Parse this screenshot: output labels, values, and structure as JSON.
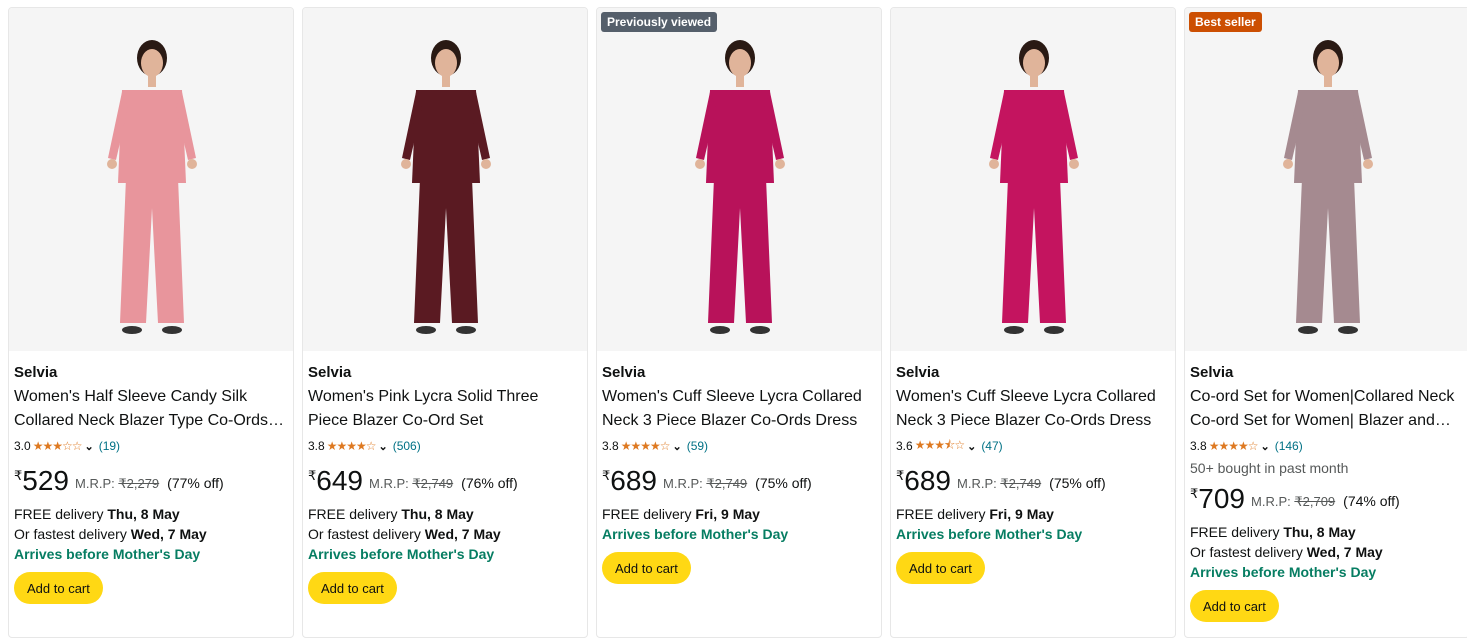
{
  "products": [
    {
      "badge": "",
      "brand": "Selvia",
      "title": "Women's Half Sleeve Candy Silk Collared Neck Blazer Type Co-Ords Set",
      "rating": "3.0",
      "stars": "★★★☆☆",
      "reviews": "(19)",
      "bought": "",
      "currency": "₹",
      "price": "529",
      "mrp_label": "M.R.P:",
      "mrp": "₹2,279",
      "discount": "(77% off)",
      "delivery_prefix": "FREE delivery",
      "delivery_date": "Thu, 8 May",
      "fast_prefix": "Or fastest delivery",
      "fast_date": "Wed, 7 May",
      "arrives": "Arrives before Mother's Day",
      "cart_label": "Add to cart",
      "outfit_color": "#e8959c"
    },
    {
      "badge": "",
      "brand": "Selvia",
      "title": "Women's Pink Lycra Solid Three Piece Blazer Co-Ord Set",
      "rating": "3.8",
      "stars": "★★★★☆",
      "reviews": "(506)",
      "bought": "",
      "currency": "₹",
      "price": "649",
      "mrp_label": "M.R.P:",
      "mrp": "₹2,749",
      "discount": "(76% off)",
      "delivery_prefix": "FREE delivery",
      "delivery_date": "Thu, 8 May",
      "fast_prefix": "Or fastest delivery",
      "fast_date": "Wed, 7 May",
      "arrives": "Arrives before Mother's Day",
      "cart_label": "Add to cart",
      "outfit_color": "#5a1a22"
    },
    {
      "badge": "Previously viewed",
      "brand": "Selvia",
      "title": "Women's Cuff Sleeve Lycra Collared Neck 3 Piece Blazer Co-Ords Dress",
      "rating": "3.8",
      "stars": "★★★★☆",
      "reviews": "(59)",
      "bought": "",
      "currency": "₹",
      "price": "689",
      "mrp_label": "M.R.P:",
      "mrp": "₹2,749",
      "discount": "(75% off)",
      "delivery_prefix": "FREE delivery",
      "delivery_date": "Fri, 9 May",
      "fast_prefix": "",
      "fast_date": "",
      "arrives": "Arrives before Mother's Day",
      "cart_label": "Add to cart",
      "outfit_color": "#b8125a"
    },
    {
      "badge": "",
      "brand": "Selvia",
      "title": "Women's Cuff Sleeve Lycra Collared Neck 3 Piece Blazer Co-Ords Dress",
      "rating": "3.6",
      "stars": "★★★⯪☆",
      "reviews": "(47)",
      "bought": "",
      "currency": "₹",
      "price": "689",
      "mrp_label": "M.R.P:",
      "mrp": "₹2,749",
      "discount": "(75% off)",
      "delivery_prefix": "FREE delivery",
      "delivery_date": "Fri, 9 May",
      "fast_prefix": "",
      "fast_date": "",
      "arrives": "Arrives before Mother's Day",
      "cart_label": "Add to cart",
      "outfit_color": "#c4145f"
    },
    {
      "badge": "Best seller",
      "brand": "Selvia",
      "title": "Co-ord Set for Women|Collared Neck Co-ord Set for Women| Blazer and Pant Set",
      "rating": "3.8",
      "stars": "★★★★☆",
      "reviews": "(146)",
      "bought": "50+ bought in past month",
      "currency": "₹",
      "price": "709",
      "mrp_label": "M.R.P:",
      "mrp": "₹2,709",
      "discount": "(74% off)",
      "delivery_prefix": "FREE delivery",
      "delivery_date": "Thu, 8 May",
      "fast_prefix": "Or fastest delivery",
      "fast_date": "Wed, 7 May",
      "arrives": "Arrives before Mother's Day",
      "cart_label": "Add to cart",
      "outfit_color": "#a58a90"
    }
  ]
}
